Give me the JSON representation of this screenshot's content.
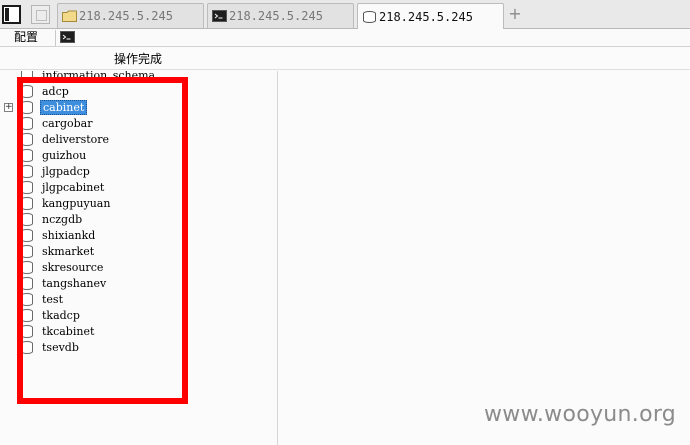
{
  "tabs": [
    {
      "label": "218.245.5.245",
      "icon": "folder-icon",
      "active": false
    },
    {
      "label": "218.245.5.245",
      "icon": "terminal-icon",
      "active": false
    },
    {
      "label": "218.245.5.245",
      "icon": "database-icon",
      "active": true
    }
  ],
  "tab_add_label": "+",
  "toolbar": {
    "config_label": "配置"
  },
  "status": {
    "message": "操作完成"
  },
  "tree": {
    "items": [
      {
        "label": "information_schema"
      },
      {
        "label": "adcp"
      },
      {
        "label": "cabinet",
        "selected": true,
        "expander": "⊞"
      },
      {
        "label": "cargobar"
      },
      {
        "label": "deliverstore"
      },
      {
        "label": "guizhou"
      },
      {
        "label": "jlgpadcp"
      },
      {
        "label": "jlgpcabinet"
      },
      {
        "label": "kangpuyuan"
      },
      {
        "label": "nczgdb"
      },
      {
        "label": "shixiankd"
      },
      {
        "label": "skmarket"
      },
      {
        "label": "skresource"
      },
      {
        "label": "tangshanev"
      },
      {
        "label": "test"
      },
      {
        "label": "tkadcp"
      },
      {
        "label": "tkcabinet"
      },
      {
        "label": "tsevdb"
      }
    ]
  },
  "colors": {
    "selection": "#3e8ede",
    "annotation": "#ff0000"
  },
  "watermark": "www.wooyun.org"
}
